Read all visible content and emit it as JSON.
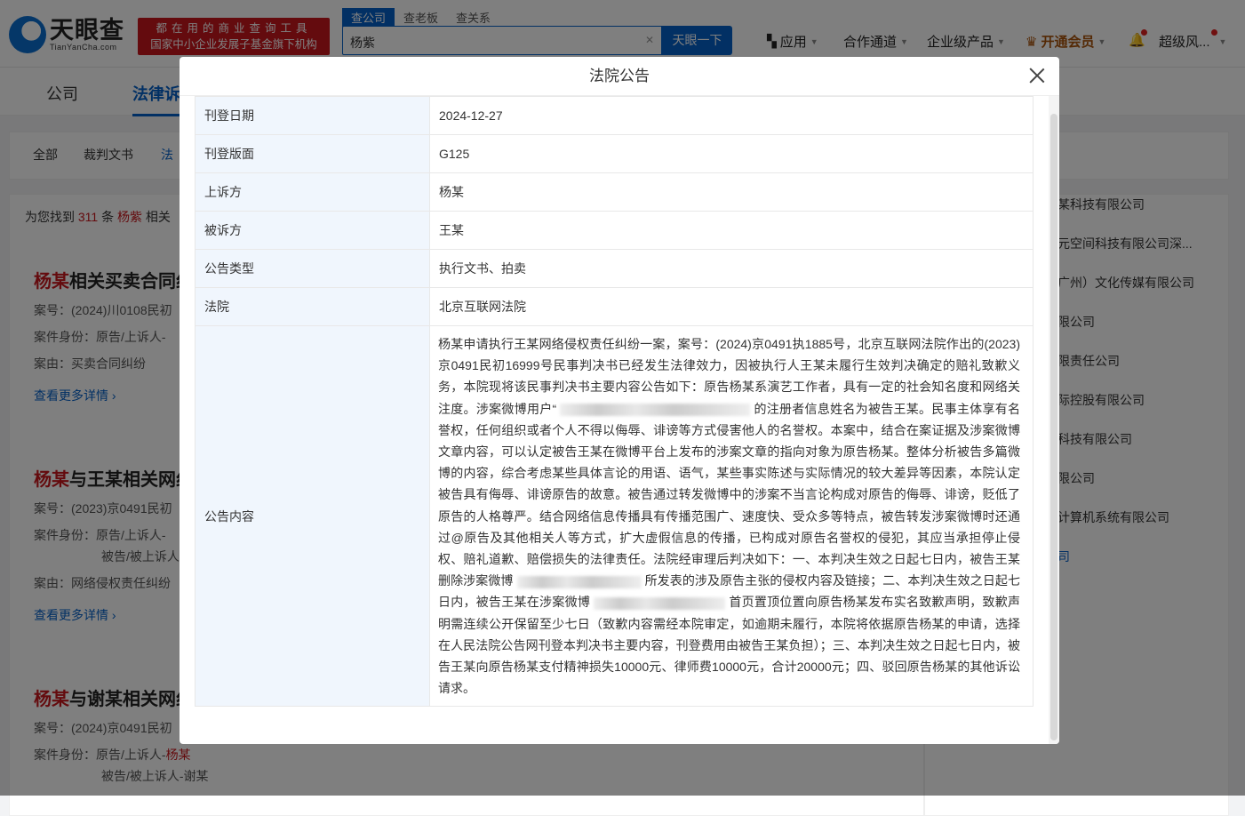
{
  "header": {
    "logo_cn": "天眼查",
    "logo_en": "TianYanCha.com",
    "slogan_1": "都在用的商业查询工具",
    "slogan_2": "国家中小企业发展子基金旗下机构",
    "search_tabs": [
      "查公司",
      "查老板",
      "查关系"
    ],
    "search_value": "杨紫",
    "search_button": "天眼一下",
    "nav": {
      "apps": "应用",
      "partner": "合作通道",
      "enterprise": "企业级产品",
      "vip": "开通会员",
      "user": "超级风..."
    }
  },
  "page_tabs": [
    "公司",
    "法律诉"
  ],
  "filters": [
    "全部",
    "裁判文书",
    "法"
  ],
  "result_summary": {
    "prefix": "为您找到",
    "count": "311",
    "mid": "条",
    "keyword": "杨紫",
    "suffix": "相关"
  },
  "cards": [
    {
      "title_hl": "杨某",
      "title": "相关买卖合同纠",
      "lines": [
        "案号：(2024)川0108民初",
        "案件身份：原告/上诉人-",
        "案由：买卖合同纠纷"
      ],
      "more": "查看更多详情"
    },
    {
      "title_hl": "杨某",
      "title": "与王某相关网纠",
      "lines": [
        "案号：(2023)京0491民初",
        "案件身份：原告/上诉人-",
        "被告/被上诉人",
        "案由：网络侵权责任纠纷"
      ],
      "more": "查看更多详情"
    },
    {
      "title_hl": "杨某",
      "title": "与谢某相关网纠",
      "lines": [
        "案号：(2024)京0491民初",
        "案件身份：原告/上诉人-",
        "被告/被上诉人-谢某"
      ],
      "party": "杨某"
    }
  ],
  "right_list": [
    "某科技有限公司",
    "元空间科技有限公司深...",
    "广州）文化传媒有限公司",
    "限公司",
    "限责任公司",
    "际控股有限公司",
    "科技有限公司",
    "限公司",
    "计算机系统有限公司",
    "司"
  ],
  "modal": {
    "title": "法院公告",
    "rows": [
      {
        "label": "刊登日期",
        "value": "2024-12-27"
      },
      {
        "label": "刊登版面",
        "value": "G125"
      },
      {
        "label": "上诉方",
        "value": "杨某"
      },
      {
        "label": "被诉方",
        "value": "王某"
      },
      {
        "label": "公告类型",
        "value": "执行文书、拍卖"
      },
      {
        "label": "法院",
        "value": "北京互联网法院"
      }
    ],
    "content_label": "公告内容",
    "content_parts": [
      "杨某申请执行王某网络侵权责任纠纷一案，案号：(2024)京0491执1885号，北京互联网法院作出的(2023)京0491民初16999号民事判决书已经发生法律效力，因被执行人王某未履行生效判决确定的赔礼致歉义务，本院现将该民事判决书主要内容公告如下：原告杨某系演艺工作者，具有一定的社会知名度和网络关注度。涉案微博用户“",
      "的注册者信息姓名为被告王某。民事主体享有名誉权，任何组织或者个人不得以侮辱、诽谤等方式侵害他人的名誉权。本案中，结合在案证据及涉案微博文章内容，可以认定被告王某在微博平台上发布的涉案文章的指向对象为原告杨某。整体分析被告多篇微博的内容，综合考虑某些具体言论的用语、语气，某些事实陈述与实际情况的较大差异等因素，本院认定被告具有侮辱、诽谤原告的故意。被告通过转发微博中的涉案不当言论构成对原告的侮辱、诽谤，贬低了原告的人格尊严。结合网络信息传播具有传播范围广、速度快、受众多等特点，被告转发涉案微博时还通过@原告及其他相关人等方式，扩大虚假信息的传播，已构成对原告名誉权的侵犯，其应当承担停止侵权、赔礼道歉、赔偿损失的法律责任。法院经审理后判决如下：一、本判决生效之日起七日内，被告王某删除涉案微博",
      "所发表的涉及原告主张的侵权内容及链接；二、本判决生效之日起七日内，被告王某在涉案微博",
      "首页置顶位置向原告杨某发布实名致歉声明，致歉声明需连续公开保留至少七日（致歉内容需经本院审定，如逾期未履行，本院将依据原告杨某的申请，选择在人民法院公告网刊登本判决书主要内容，刊登费用由被告王某负担）；三、本判决生效之日起七日内，被告王某向原告杨某支付精神损失10000元、律师费10000元，合计20000元；四、驳回原告杨某的其他诉讼请求。"
    ]
  }
}
